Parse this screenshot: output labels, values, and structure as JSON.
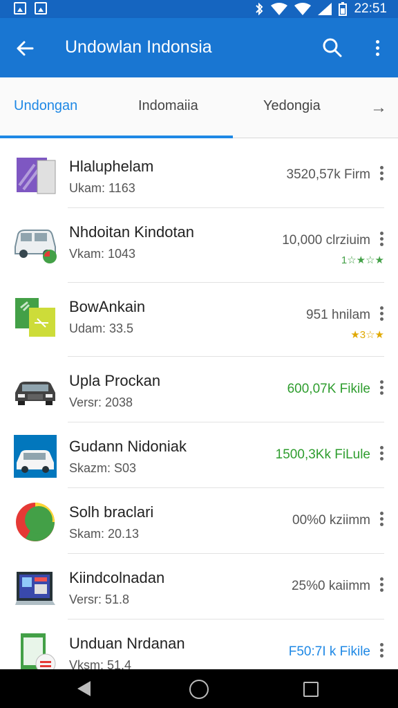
{
  "status_bar": {
    "time": "22:51"
  },
  "app_bar": {
    "title": "Undowlan Indonsia"
  },
  "tabs": [
    {
      "label": "Undongan",
      "active": true
    },
    {
      "label": "Indomaiia",
      "active": false
    },
    {
      "label": "Yedongia",
      "active": false
    }
  ],
  "apps": [
    {
      "name": "Hlaluphelam",
      "sub": "Ukam: 1163",
      "size": "3520,57k Firm",
      "size_color": "gray",
      "stars": ""
    },
    {
      "name": "Nhdoitan Kindotan",
      "sub": "Vkam: 1043",
      "size": "10,000 clrziuim",
      "size_color": "gray",
      "stars": "1☆★☆★"
    },
    {
      "name": "BowAnkain",
      "sub": "Udam: 33.5",
      "size": "951 hnilam",
      "size_color": "gray",
      "stars": "★3☆★"
    },
    {
      "name": "Upla Prockan",
      "sub": "Versr: 2038",
      "size": "600,07K Fikile",
      "size_color": "green",
      "stars": ""
    },
    {
      "name": "Gudann Nidoniak",
      "sub": "Skazm: S03",
      "size": "1500,3Kk FiLule",
      "size_color": "green",
      "stars": ""
    },
    {
      "name": "Solh braclari",
      "sub": "Skam: 20.13",
      "size": "00%0 kziimm",
      "size_color": "gray",
      "stars": ""
    },
    {
      "name": "Kiindcolnadan",
      "sub": "Versr: 51.8",
      "size": "25%0 kaiimm",
      "size_color": "gray",
      "stars": ""
    },
    {
      "name": "Unduan Nrdanan",
      "sub": "Vksm: 51.4",
      "size": "F50:7I k Fikile",
      "size_color": "blue",
      "stars": ""
    }
  ],
  "colors": {
    "app_bar": "#1976d2",
    "status_bar": "#1565c0",
    "accent": "#1e88e5",
    "green": "#2e9d2e"
  }
}
